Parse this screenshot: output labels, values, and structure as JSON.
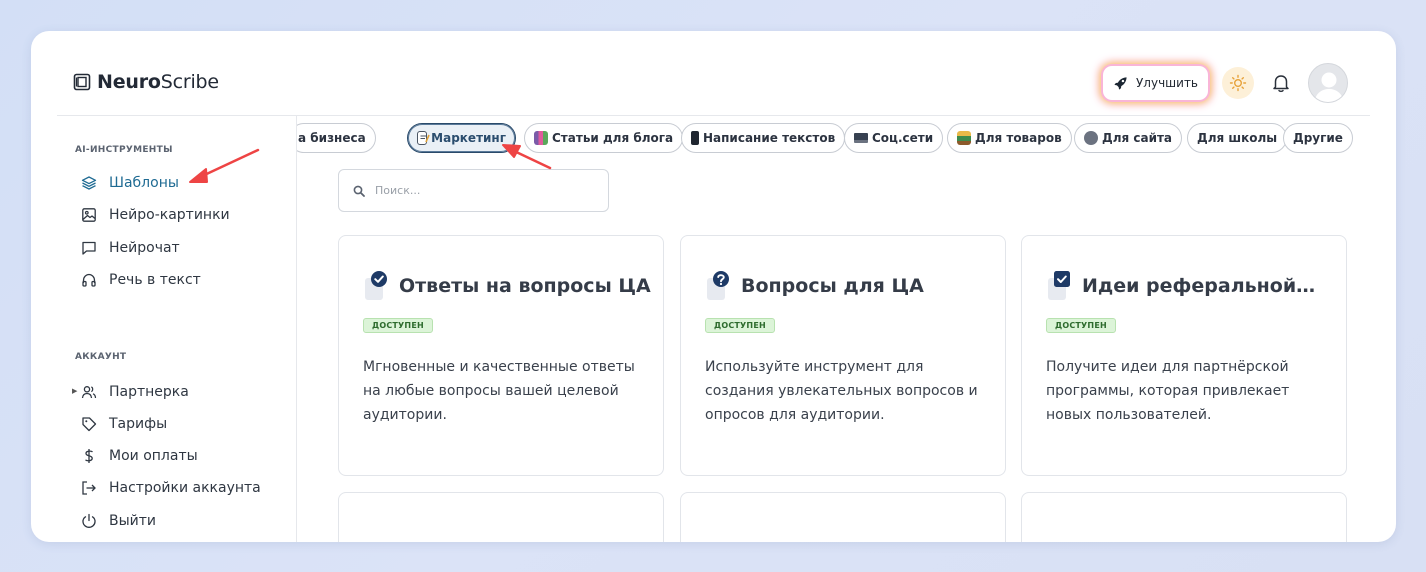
{
  "app": {
    "logo_bold": "Neuro",
    "logo_light": "Scribe"
  },
  "header": {
    "upgrade_label": "Улучшить"
  },
  "sidebar": {
    "section_tools": "AI-ИНСТРУМЕНТЫ",
    "tools": [
      {
        "label": "Шаблоны",
        "icon": "layers-icon",
        "active": true
      },
      {
        "label": "Нейро-картинки",
        "icon": "image-icon"
      },
      {
        "label": "Нейрочат",
        "icon": "chat-icon"
      },
      {
        "label": "Речь в текст",
        "icon": "headphones-icon"
      }
    ],
    "section_account": "АККАУНТ",
    "account": [
      {
        "label": "Партнерка",
        "icon": "users-icon"
      },
      {
        "label": "Тарифы",
        "icon": "tag-icon"
      },
      {
        "label": "Мои оплаты",
        "icon": "dollar-icon"
      },
      {
        "label": "Настройки аккаунта",
        "icon": "logout-arrow-icon"
      },
      {
        "label": "Выйти",
        "icon": "power-icon"
      }
    ]
  },
  "categories": [
    {
      "label": "а бизнеса"
    },
    {
      "label": "Маркетинг",
      "active": true
    },
    {
      "label": "Статьи для блога"
    },
    {
      "label": "Написание текстов"
    },
    {
      "label": "Соц.сети"
    },
    {
      "label": "Для товаров"
    },
    {
      "label": "Для сайта"
    },
    {
      "label": "Для школы"
    },
    {
      "label": "Другие"
    }
  ],
  "search": {
    "placeholder": "Поиск..."
  },
  "cards": [
    {
      "title": "Ответы на вопросы ЦА",
      "badge": "ДОСТУПЕН",
      "description": "Мгновенные и качественные ответы на любые вопросы вашей целевой аудитории.",
      "icon": "check-circle-icon"
    },
    {
      "title": "Вопросы для ЦА",
      "badge": "ДОСТУПЕН",
      "description": "Используйте инструмент для создания увлекательных вопросов и опросов для аудитории.",
      "icon": "question-circle-icon"
    },
    {
      "title": "Идеи реферальной…",
      "badge": "ДОСТУПЕН",
      "description": "Получите идеи для партнёрской программы, которая привлекает новых пользователей.",
      "icon": "check-square-icon"
    }
  ],
  "colors": {
    "accent": "#1f6b93",
    "badge_bg": "#dcf4d8",
    "annotation_arrow": "#ee4444"
  }
}
